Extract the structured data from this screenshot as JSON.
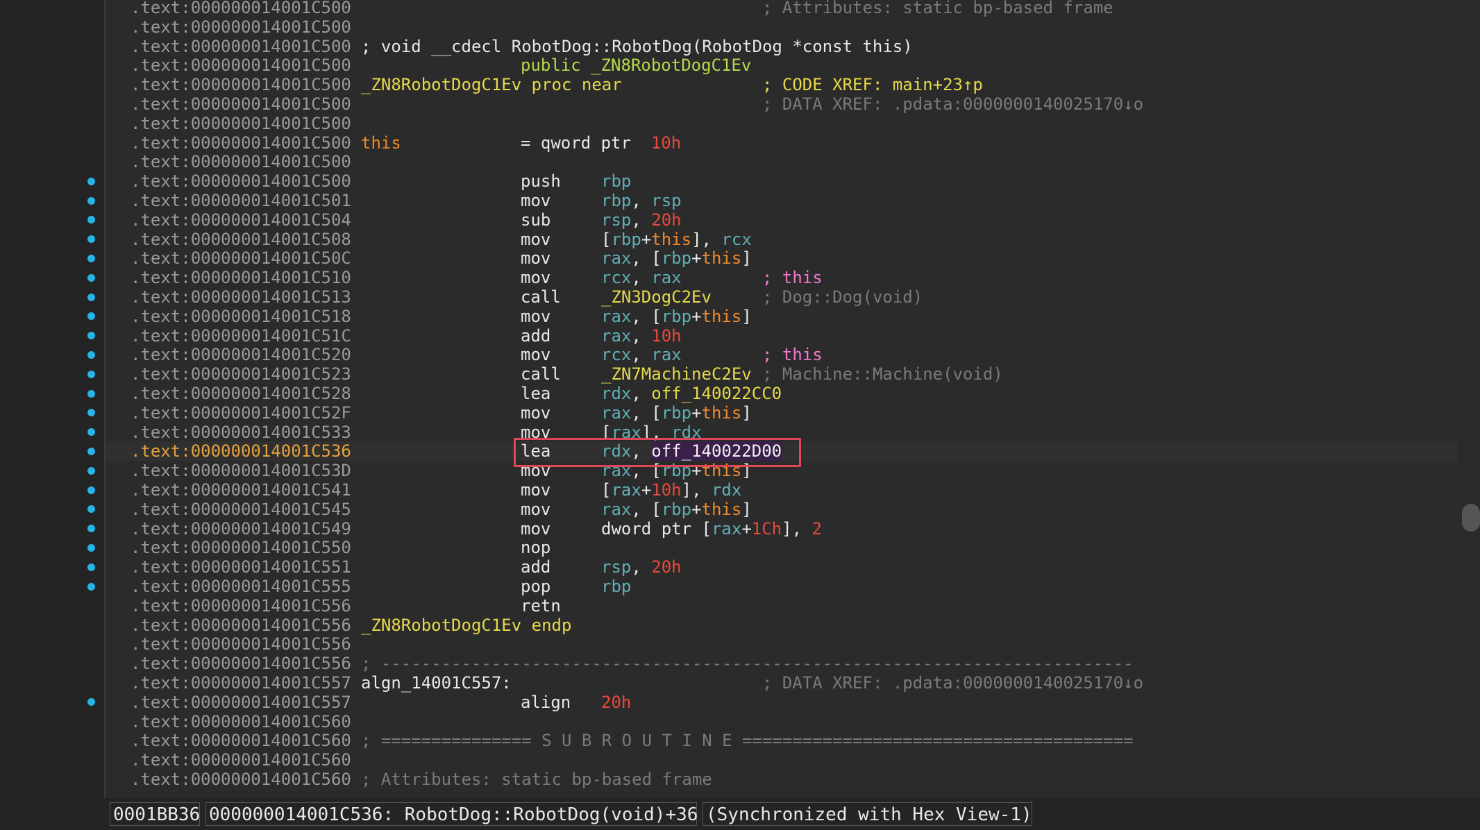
{
  "rows": [
    {
      "addr": ".text:000000014001C500",
      "cm": "; Attributes: static bp-based frame",
      "cmc": "c-gray"
    },
    {
      "addr": ".text:000000014001C500"
    },
    {
      "addr": ".text:000000014001C500",
      "lbl": "; void __cdecl RobotDog::RobotDog(RobotDog *const this)",
      "lblc": "c-white"
    },
    {
      "addr": ".text:000000014001C500",
      "mn": "public _ZN8RobotDogC1Ev",
      "mnc": "c-green"
    },
    {
      "addr": ".text:000000014001C500",
      "lbl": "_ZN8RobotDogC1Ev proc near",
      "lblc": "c-yellow",
      "cm": "; CODE XREF: main+23↑p",
      "cmc": "c-yellow"
    },
    {
      "addr": ".text:000000014001C500",
      "cm": "; DATA XREF: .pdata:0000000140025170↓o",
      "cmc": "c-gray"
    },
    {
      "addr": ".text:000000014001C500"
    },
    {
      "addr": ".text:000000014001C500",
      "lbl": "this",
      "lblc": "c-orange",
      "mn": "= qword ptr  ",
      "op_raw": "10h",
      "opc": "c-red"
    },
    {
      "addr": ".text:000000014001C500"
    },
    {
      "addr": ".text:000000014001C500",
      "mn": "push",
      "op": "rbp"
    },
    {
      "addr": ".text:000000014001C501",
      "mn": "mov",
      "op": "rbp, rsp"
    },
    {
      "addr": ".text:000000014001C504",
      "mn": "sub",
      "op": "rsp, 20h"
    },
    {
      "addr": ".text:000000014001C508",
      "mn": "mov",
      "op": "[rbp+this], rcx"
    },
    {
      "addr": ".text:000000014001C50C",
      "mn": "mov",
      "op": "rax, [rbp+this]"
    },
    {
      "addr": ".text:000000014001C510",
      "mn": "mov",
      "op": "rcx, rax",
      "cm": "; this",
      "cmc": "c-pink"
    },
    {
      "addr": ".text:000000014001C513",
      "mn": "call",
      "op": "_ZN3DogC2Ev",
      "cm": "; Dog::Dog(void)",
      "cmc": "c-gray"
    },
    {
      "addr": ".text:000000014001C518",
      "mn": "mov",
      "op": "rax, [rbp+this]"
    },
    {
      "addr": ".text:000000014001C51C",
      "mn": "add",
      "op": "rax, 10h"
    },
    {
      "addr": ".text:000000014001C520",
      "mn": "mov",
      "op": "rcx, rax",
      "cm": "; this",
      "cmc": "c-pink"
    },
    {
      "addr": ".text:000000014001C523",
      "mn": "call",
      "op": "_ZN7MachineC2Ev",
      "cm": "; Machine::Machine(void)",
      "cmc": "c-gray"
    },
    {
      "addr": ".text:000000014001C528",
      "mn": "lea",
      "op": "rdx, off_140022CC0"
    },
    {
      "addr": ".text:000000014001C52F",
      "mn": "mov",
      "op": "rax, [rbp+this]"
    },
    {
      "addr": ".text:000000014001C533",
      "mn": "mov",
      "op": "[rax], rdx"
    },
    {
      "addr": ".text:000000014001C536",
      "mn": "lea",
      "op": "rdx, off_140022D00",
      "current": true
    },
    {
      "addr": ".text:000000014001C53D",
      "mn": "mov",
      "op": "rax, [rbp+this]"
    },
    {
      "addr": ".text:000000014001C541",
      "mn": "mov",
      "op": "[rax+10h], rdx"
    },
    {
      "addr": ".text:000000014001C545",
      "mn": "mov",
      "op": "rax, [rbp+this]"
    },
    {
      "addr": ".text:000000014001C549",
      "mn": "mov",
      "op": "dword ptr [rax+1Ch], 2"
    },
    {
      "addr": ".text:000000014001C550",
      "mn": "nop"
    },
    {
      "addr": ".text:000000014001C551",
      "mn": "add",
      "op": "rsp, 20h"
    },
    {
      "addr": ".text:000000014001C555",
      "mn": "pop",
      "op": "rbp"
    },
    {
      "addr": ".text:000000014001C556",
      "mn": "retn"
    },
    {
      "addr": ".text:000000014001C556",
      "lbl": "_ZN8RobotDogC1Ev endp",
      "lblc": "c-yellow"
    },
    {
      "addr": ".text:000000014001C556"
    },
    {
      "addr": ".text:000000014001C556",
      "lbl": "; ---------------------------------------------------------------------------",
      "lblc": "c-gray"
    },
    {
      "addr": ".text:000000014001C557",
      "lbl": "algn_14001C557:",
      "lblc": "c-white",
      "cm": "; DATA XREF: .pdata:0000000140025170↓o",
      "cmc": "c-gray"
    },
    {
      "addr": ".text:000000014001C557",
      "mn": "align",
      "op": "20h"
    },
    {
      "addr": ".text:000000014001C560"
    },
    {
      "addr": ".text:000000014001C560",
      "lbl": "; =============== S U B R O U T I N E =======================================",
      "lblc": "c-gray"
    },
    {
      "addr": ".text:000000014001C560"
    },
    {
      "addr": ".text:000000014001C560",
      "lbl": "; Attributes: static bp-based frame",
      "lblc": "c-gray"
    }
  ],
  "breakpoint_rows": [
    9,
    10,
    11,
    12,
    13,
    14,
    15,
    16,
    17,
    18,
    19,
    20,
    21,
    22,
    23,
    24,
    25,
    26,
    27,
    28,
    29,
    30,
    36
  ],
  "statusbar": {
    "offset": "0001BB36",
    "location": "000000014001C536: RobotDog::RobotDog(void)+36",
    "sync": "(Synchronized with Hex View-1)"
  }
}
